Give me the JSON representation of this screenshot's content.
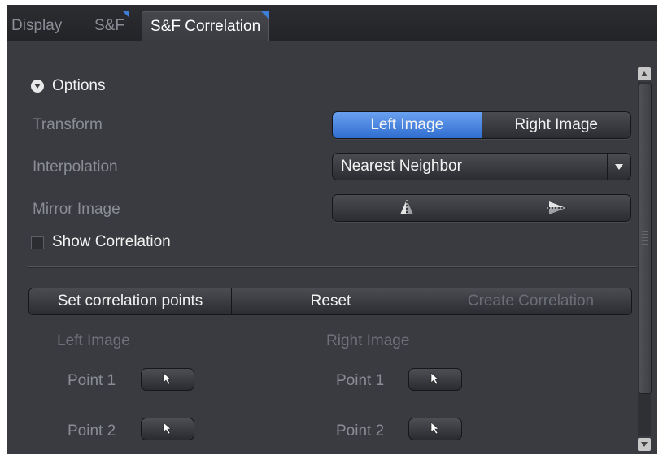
{
  "tabs": [
    {
      "label": "Display",
      "active": false
    },
    {
      "label": "S&F",
      "active": false
    },
    {
      "label": "S&F Correlation",
      "active": true
    }
  ],
  "options": {
    "label": "Options",
    "expanded": true
  },
  "transform": {
    "label": "Transform",
    "segments": [
      "Left Image",
      "Right Image"
    ],
    "selected": "Left Image"
  },
  "interpolation": {
    "label": "Interpolation",
    "value": "Nearest Neighbor"
  },
  "mirror": {
    "label": "Mirror Image",
    "buttons": [
      "mirror-vertical-icon",
      "mirror-horizontal-icon"
    ]
  },
  "show_correlation": {
    "label": "Show Correlation",
    "checked": false
  },
  "actions": {
    "set_points": "Set correlation points",
    "reset": "Reset",
    "create": "Create Correlation"
  },
  "left_image": {
    "heading": "Left Image",
    "points": [
      "Point 1",
      "Point 2"
    ]
  },
  "right_image": {
    "heading": "Right Image",
    "points": [
      "Point 1",
      "Point 2"
    ]
  },
  "colors": {
    "background": "#3a3b40",
    "accent": "#3f7fd8",
    "label": "#8a8d94",
    "text": "#f2f2f2"
  }
}
